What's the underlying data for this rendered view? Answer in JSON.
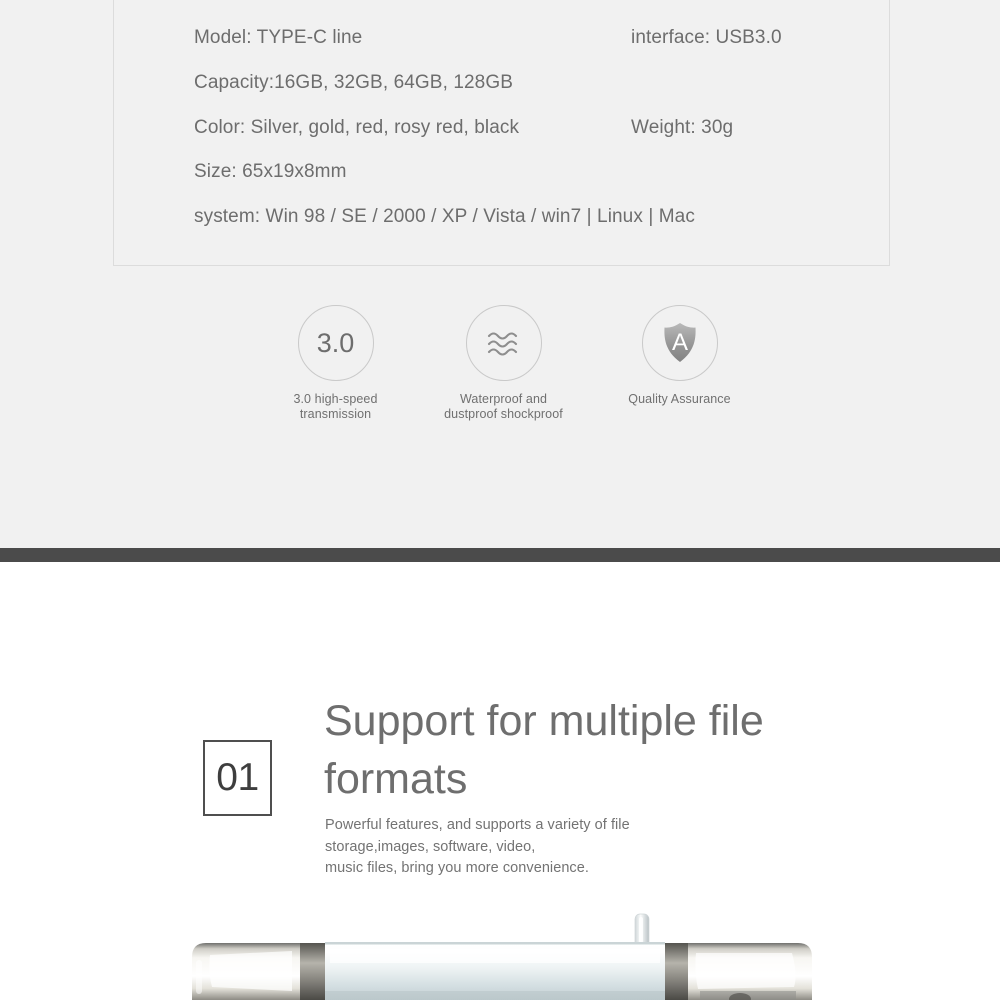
{
  "theme": {
    "page_bg": "#ffffff",
    "top_section_bg": "#f1f1f1",
    "divider_band_color": "#4b4b4b",
    "spec_border_color": "#dcdcdc",
    "text_gray": "#6d6d6d",
    "heading_gray": "#6e6e6e",
    "number_box_border": "#4f4f4f"
  },
  "spec_box": {
    "rows": [
      {
        "left": "Model: TYPE-C line",
        "right": "interface: USB3.0"
      },
      {
        "left": "Capacity:16GB, 32GB, 64GB, 128GB",
        "right": ""
      },
      {
        "left": "Color: Silver, gold, red, rosy red, black",
        "right": "Weight: 30g"
      },
      {
        "left": "Size: 65x19x8mm",
        "right": ""
      },
      {
        "left": "system: Win 98 / SE / 2000 / XP / Vista / win7 | Linux | Mac",
        "right": ""
      }
    ]
  },
  "features": [
    {
      "icon": "usb-3-0-circle-icon",
      "badge_text": "3.0",
      "caption_line1": "3.0 high-speed",
      "caption_line2": "transmission"
    },
    {
      "icon": "water-waves-circle-icon",
      "badge_text": "",
      "caption_line1": "Waterproof and",
      "caption_line2": "dustproof shockproof"
    },
    {
      "icon": "shield-a-quality-circle-icon",
      "badge_text": "A",
      "caption_line1": "Quality Assurance",
      "caption_line2": ""
    }
  ],
  "divider": {
    "arrow_icon": "chevron-down-arrow-icon"
  },
  "section_01": {
    "number": "01",
    "heading": "Support for multiple file formats",
    "body_lines": [
      "Powerful features, and supports a variety of file",
      "storage,images, software, video,",
      "music files, bring you more convenience."
    ]
  },
  "product_photo": {
    "alt": "usb-flash-drive-photo"
  }
}
